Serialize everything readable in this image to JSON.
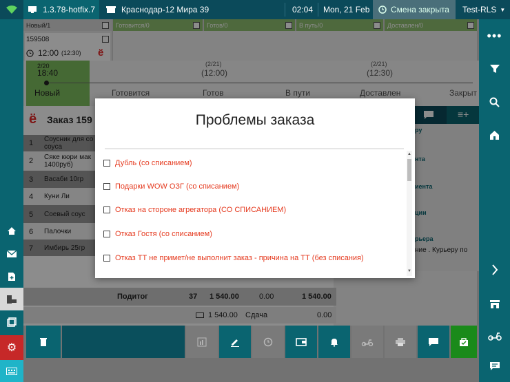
{
  "topbar": {
    "version": "1.3.78-hotfix.7",
    "store": "Краснодар-12 Мира 39",
    "time": "02:04",
    "date": "Mon, 21 Feb",
    "shift": "Смена закрыта",
    "account": "Test-RLS"
  },
  "columns": [
    {
      "label": "Новый/1"
    },
    {
      "label": "Готовится/0"
    },
    {
      "label": "Готов/0"
    },
    {
      "label": "В путь/0"
    },
    {
      "label": "Доставлен/0"
    }
  ],
  "order_card": {
    "number": "159508",
    "time": "12:00",
    "time_sub": "(12:30)"
  },
  "timeline": {
    "current_frac": "2/20",
    "current_time": "18:40",
    "steps": [
      {
        "label": "Новый",
        "frac": "",
        "time": ""
      },
      {
        "label": "Готовится",
        "frac": "",
        "time": ""
      },
      {
        "label": "Готов",
        "frac": "(2/21)",
        "time": "(12:00)"
      },
      {
        "label": "В пути",
        "frac": "",
        "time": ""
      },
      {
        "label": "Доставлен",
        "frac": "(2/21)",
        "time": "(12:30)"
      },
      {
        "label": "Закрыт",
        "frac": "",
        "time": ""
      }
    ]
  },
  "order": {
    "title": "Заказ 159",
    "items": [
      {
        "n": "1",
        "name": "Соусник для со\nсоуса"
      },
      {
        "n": "2",
        "name": "Сяке кюри мак\n1400руб)"
      },
      {
        "n": "3",
        "name": "Васаби 10гр"
      },
      {
        "n": "4",
        "name": "Куни Ли"
      },
      {
        "n": "5",
        "name": "Соевый соус"
      },
      {
        "n": "6",
        "name": "Палочки"
      },
      {
        "n": "7",
        "name": "Имбирь 25гр"
      }
    ],
    "subtotal_label": "Подитог",
    "qty": "37",
    "sum": "1 540.00",
    "discount": "0.00",
    "total": "1 540.00",
    "paid": "1 540.00",
    "change_label": "Сдача",
    "change": "0.00"
  },
  "right_panel": {
    "lines": [
      "ру",
      "нта",
      "иента",
      "ции",
      "рьера",
      "ние . Курьеру по"
    ]
  },
  "modal": {
    "title": "Проблемы заказа",
    "items": [
      {
        "label": "Дубль (со списанием)"
      },
      {
        "label": "Подарки WOW ОЗГ (со списанием)"
      },
      {
        "label": "Отказ на стороне агрегатора (СО СПИСАНИЕМ)"
      },
      {
        "label": "Отказ Гостя (со списанием)"
      },
      {
        "label": "Отказ ТТ не примет/не выполнит заказ - причина на ТТ (без списания)"
      }
    ]
  },
  "colors": {
    "teal": "#0a6470",
    "topbar": "#0b4a5a",
    "green": "#8fbf6f",
    "problem_text": "#e53a1f"
  }
}
